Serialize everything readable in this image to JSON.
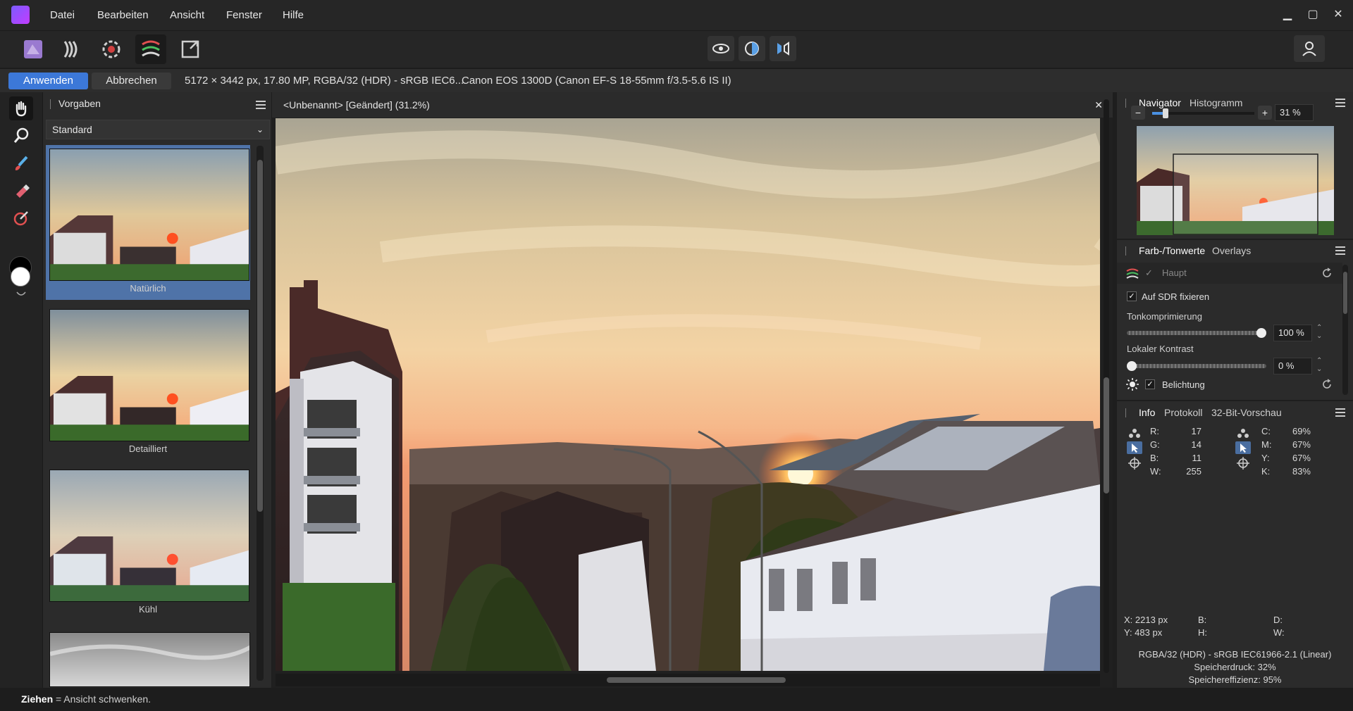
{
  "menu": [
    "Datei",
    "Bearbeiten",
    "Ansicht",
    "Fenster",
    "Hilfe"
  ],
  "window": {
    "min": "▁",
    "max": "▢",
    "close": "✕"
  },
  "context_bar": {
    "apply": "Anwenden",
    "cancel": "Abbrechen",
    "image_info": "5172 × 3442 px, 17.80 MP, RGBA/32 (HDR) - sRGB IEC6...",
    "camera": "Canon EOS 1300D (Canon EF-S 18-55mm f/3.5-5.6 IS II)"
  },
  "presets": {
    "tab": "Vorgaben",
    "selected": "Standard",
    "items": [
      {
        "label": "Natürlich"
      },
      {
        "label": "Detailliert"
      },
      {
        "label": "Kühl"
      }
    ]
  },
  "document": {
    "title": "<Unbenannt> [Geändert] (31.2%)",
    "close": "✕"
  },
  "navigator": {
    "tabs": [
      "Navigator",
      "Histogramm"
    ],
    "zoom": "31 %",
    "minus": "−",
    "plus": "+"
  },
  "adjust": {
    "tabs": [
      "Farb-/Tonwerte",
      "Overlays"
    ],
    "haupt": "Haupt",
    "sdr_label": "Auf SDR fixieren",
    "ton_label": "Tonkomprimierung",
    "ton_value": "100 %",
    "ton_level": 1.0,
    "kontrast_label": "Lokaler Kontrast",
    "kontrast_value": "0 %",
    "kontrast_level": 0.0,
    "belichtung": "Belichtung"
  },
  "info": {
    "tabs": [
      "Info",
      "Protokoll",
      "32-Bit-Vorschau"
    ],
    "rgb": [
      {
        "k": "R:",
        "v": "17"
      },
      {
        "k": "G:",
        "v": "14"
      },
      {
        "k": "B:",
        "v": "11"
      },
      {
        "k": "W:",
        "v": "255"
      }
    ],
    "cmyk": [
      {
        "k": "C:",
        "v": "69%"
      },
      {
        "k": "M:",
        "v": "67%"
      },
      {
        "k": "Y:",
        "v": "67%"
      },
      {
        "k": "K:",
        "v": "83%"
      }
    ],
    "x": "X: 2213 px",
    "y": "Y: 483 px",
    "b": "B:",
    "h": "H:",
    "d": "D:",
    "w": "W:",
    "profile": "RGBA/32 (HDR) - sRGB IEC61966-2.1 (Linear)",
    "mem1": "Speicherdruck: 32%",
    "mem2": "Speichereffizienz: 95%"
  },
  "status": {
    "bold": "Ziehen",
    "rest": " = Ansicht schwenken."
  },
  "colors": {
    "accent": "#3c78d8",
    "selection": "#4f73a8"
  }
}
